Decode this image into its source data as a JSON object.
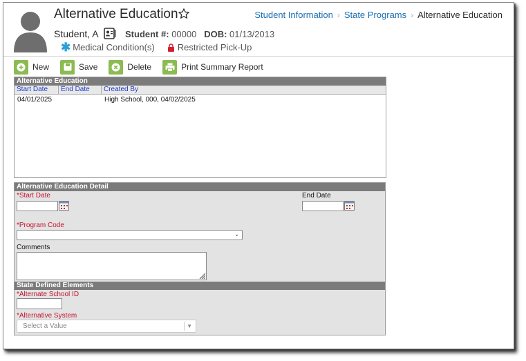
{
  "header": {
    "title": "Alternative Education",
    "breadcrumb": [
      "Student Information",
      "State Programs",
      "Alternative Education"
    ],
    "student_name": "Student, A",
    "student_number_label": "Student #:",
    "student_number": "00000",
    "dob_label": "DOB:",
    "dob": "01/13/2013",
    "flags": [
      "Medical Condition(s)",
      "Restricted Pick-Up"
    ]
  },
  "toolbar": {
    "new_label": "New",
    "save_label": "Save",
    "delete_label": "Delete",
    "print_label": "Print Summary Report"
  },
  "list": {
    "title": "Alternative Education",
    "columns": [
      "Start Date",
      "End Date",
      "Created By"
    ],
    "rows": [
      {
        "start_date": "04/01/2025",
        "end_date": "",
        "created_by": "High School, 000, 04/02/2025"
      }
    ]
  },
  "detail": {
    "title": "Alternative Education Detail",
    "start_date_label": "*Start Date",
    "start_date_value": "",
    "end_date_label": "End Date",
    "end_date_value": "",
    "program_code_label": "*Program Code",
    "program_code_value": "",
    "comments_label": "Comments",
    "comments_value": ""
  },
  "state_elements": {
    "title": "State Defined Elements",
    "alt_school_id_label": "*Alternate School ID",
    "alt_school_id_value": "",
    "alt_system_label": "*Alternative System",
    "alt_system_placeholder": "Select a Value"
  },
  "colors": {
    "link": "#1a6fb3",
    "required": "#c4122f",
    "toolbar_icon": "#8bbb52",
    "panel_header": "#7b7b7b",
    "column_header_text": "#1c39c5",
    "medical_icon": "#2a9fd8",
    "lock_icon": "#d3202f"
  },
  "icons": {
    "avatar": "person-silhouette-icon",
    "favorite": "star-outline-icon",
    "student_card": "id-card-icon",
    "medical": "asterisk-icon",
    "restricted": "lock-icon",
    "new": "plus-circle-icon",
    "save": "floppy-disk-icon",
    "delete": "x-circle-icon",
    "print": "printer-icon",
    "calendar": "calendar-icon"
  }
}
